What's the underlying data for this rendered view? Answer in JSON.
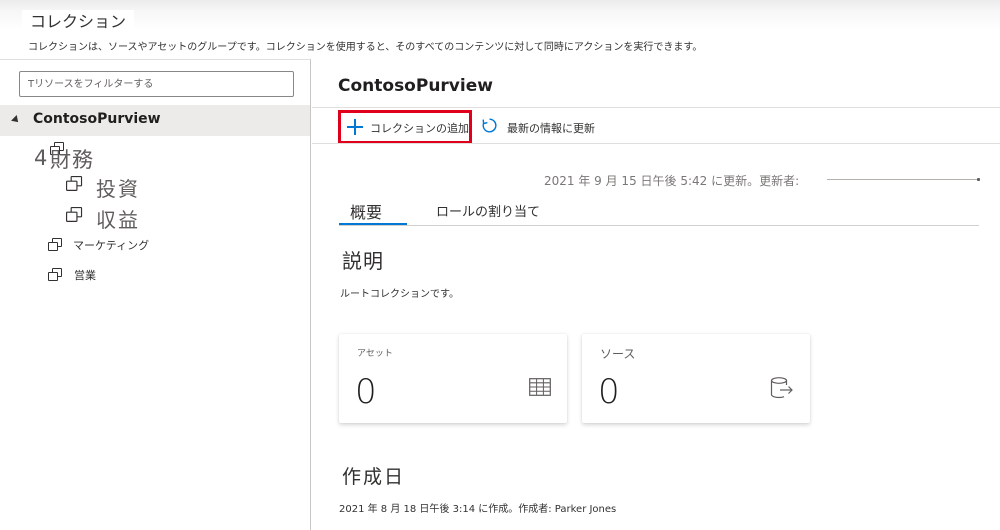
{
  "header": {
    "title": "コレクション",
    "subtitle": "コレクションは、ソースやアセットのグループです。コレクションを使用すると、そのすべてのコンテンツに対して同時にアクションを実行できます。"
  },
  "sidebar": {
    "filter_placeholder": "Tリソースをフィルターする",
    "root_label": "ContosoPurview",
    "items": [
      {
        "number": "4",
        "label": "財務",
        "icon": "collection-icon"
      },
      {
        "label": "投資",
        "icon": "collection-icon"
      },
      {
        "label": "収益",
        "icon": "collection-icon"
      },
      {
        "label": "マーケティング",
        "icon": "collection-icon"
      },
      {
        "label": "営業",
        "icon": "collection-icon"
      }
    ]
  },
  "main": {
    "title": "ContosoPurview",
    "toolbar": {
      "add_label": "コレクションの追加",
      "refresh_label": "最新の情報に更新"
    },
    "updated_text": "2021 年 9 月 15 日午後 5:42 に更新。更新者:",
    "tabs": [
      {
        "label": "概要",
        "active": true
      },
      {
        "label": "ロールの割り当て",
        "active": false
      }
    ],
    "description": {
      "heading": "説明",
      "text": "ルートコレクションです。"
    },
    "cards": [
      {
        "label": "アセット",
        "value": "0",
        "icon": "table-icon"
      },
      {
        "label": "ソース",
        "value": "0",
        "icon": "source-export-icon"
      }
    ],
    "created": {
      "heading": "作成日",
      "text": "2021 年 8 月 18 日午後 3:14 に作成。作成者: Parker Jones"
    }
  },
  "colors": {
    "accent": "#0078d4",
    "highlight_box": "#e0001b",
    "selected_row": "#edebe9"
  }
}
